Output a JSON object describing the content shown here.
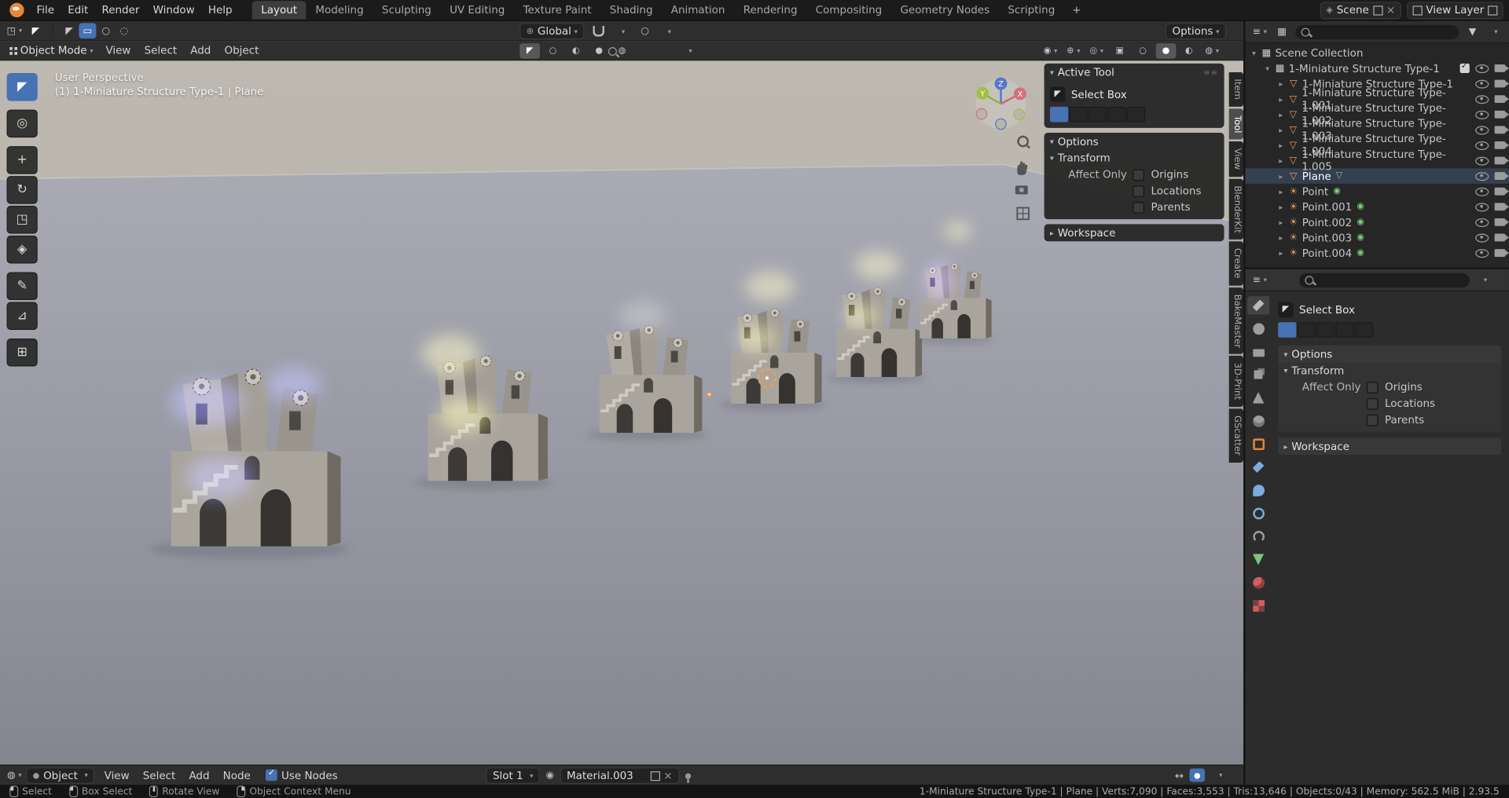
{
  "colors": {
    "accent_blue": "#4772b3",
    "accent_orange": "#e8883a",
    "header_bg": "#2e2e2e"
  },
  "topbar": {
    "menus": [
      {
        "label": "File"
      },
      {
        "label": "Edit"
      },
      {
        "label": "Render"
      },
      {
        "label": "Window"
      },
      {
        "label": "Help"
      }
    ],
    "workspaces": [
      {
        "label": "Layout",
        "cls": "active"
      },
      {
        "label": "Modeling"
      },
      {
        "label": "Sculpting"
      },
      {
        "label": "UV Editing"
      },
      {
        "label": "Texture Paint"
      },
      {
        "label": "Shading"
      },
      {
        "label": "Animation"
      },
      {
        "label": "Rendering"
      },
      {
        "label": "Compositing"
      },
      {
        "label": "Geometry Nodes"
      },
      {
        "label": "Scripting"
      }
    ],
    "add_workspace": "+",
    "scene_label": "Scene",
    "view_layer_label": "View Layer"
  },
  "tool_settings": {
    "select_modes": [
      {
        "name": "tweak-select-mode",
        "glyph": "◤"
      },
      {
        "name": "box-select-mode",
        "glyph": "▭",
        "cls": "active"
      },
      {
        "name": "circle-select-mode",
        "glyph": "○"
      },
      {
        "name": "lasso-select-mode",
        "glyph": "◌"
      }
    ],
    "orientation": "Global",
    "options_label": "Options"
  },
  "viewport_header": {
    "mode": "Object Mode",
    "menus": [
      {
        "label": "View"
      },
      {
        "label": "Select"
      },
      {
        "label": "Add"
      },
      {
        "label": "Object"
      }
    ],
    "center_icons": [
      {
        "name": "active-tool-icon",
        "glyph": "◤",
        "cls": "active"
      },
      {
        "name": "mode-wire-icon",
        "glyph": "○"
      },
      {
        "name": "mode-solid-icon",
        "glyph": "◐"
      },
      {
        "name": "mode-material-icon",
        "glyph": "●"
      },
      {
        "name": "mode-render-icon",
        "glyph": "◍"
      }
    ],
    "right_icons": [
      {
        "name": "visibility-toggle",
        "glyph": "◉",
        "dd": true
      },
      {
        "name": "gizmo-toggle",
        "glyph": "⊕",
        "dd": true
      },
      {
        "name": "overlays-toggle",
        "glyph": "◎",
        "dd": true
      },
      {
        "name": "xray-toggle",
        "glyph": "▣"
      },
      {
        "name": "shading-wireframe-toggle",
        "glyph": "○"
      },
      {
        "name": "shading-solid-toggle",
        "glyph": "●",
        "cls": "active"
      },
      {
        "name": "shading-material-toggle",
        "glyph": "◐"
      },
      {
        "name": "shading-rendered-toggle",
        "glyph": "◍",
        "dd": true
      }
    ]
  },
  "left_toolbar": [
    {
      "name": "select-box-tool",
      "glyph": "◤",
      "cls": "active"
    },
    {
      "name": "cursor-tool",
      "glyph": "◎"
    },
    {
      "name": "move-tool",
      "glyph": "+"
    },
    {
      "name": "rotate-tool",
      "glyph": "↻"
    },
    {
      "name": "scale-tool",
      "glyph": "◳"
    },
    {
      "name": "transform-tool",
      "glyph": "◈"
    },
    {
      "name": "annotate-tool",
      "glyph": "✎"
    },
    {
      "name": "measure-tool",
      "glyph": "⊿"
    },
    {
      "name": "add-cube-tool",
      "glyph": "⊞"
    }
  ],
  "viewport": {
    "perspective_label": "User Perspective",
    "context_label": "(1) 1-Miniature Structure Type-1 | Plane",
    "gizmo": {
      "x": "X",
      "y": "Y",
      "z": "Z"
    },
    "glow_colors": {
      "s1": "#5c5cf0",
      "s2": "#e3d84e",
      "s3": "#e0e0da",
      "s4": "#d9cf52",
      "s5": "#d9cf52",
      "s6": "#8a62f0"
    }
  },
  "sidebar": {
    "active_tool_header": "Active Tool",
    "tool_name": "Select Box",
    "mode_icons": [
      {
        "cls": "active"
      },
      {},
      {},
      {},
      {}
    ],
    "options_header": "Options",
    "transform_header": "Transform",
    "affect_items": [
      {
        "prefix": "Affect Only",
        "label": "Origins"
      },
      {
        "label": "Locations"
      },
      {
        "label": "Parents"
      }
    ],
    "workspace_header": "Workspace",
    "tabs": [
      {
        "label": "Item"
      },
      {
        "label": "Tool",
        "cls": "active"
      },
      {
        "label": "View"
      },
      {
        "label": "BlenderKit"
      },
      {
        "label": "Create"
      },
      {
        "label": "BakeMaster"
      },
      {
        "label": "3D-Print"
      },
      {
        "label": "GScatter"
      }
    ]
  },
  "outliner": {
    "rows": [
      {
        "label": "Scene Collection",
        "icon": "▦",
        "icon_style": "color:#cfcfcf",
        "indent": 0,
        "arrow": "▾"
      },
      {
        "label": "1-Miniature Structure Type-1",
        "icon": "▦",
        "icon_style": "color:#cfcfcf",
        "indent": 1,
        "arrow": "▾",
        "check": true,
        "eye": true,
        "cam": true
      },
      {
        "label": "1-Miniature Structure Type-1",
        "icon": "▽",
        "icon_style": "color:#ef9a54",
        "indent": 2,
        "arrow": "▸",
        "eye": true,
        "cam": true
      },
      {
        "label": "1-Miniature Structure Type-1.001",
        "icon": "▽",
        "icon_style": "color:#ef9a54",
        "indent": 2,
        "arrow": "▸",
        "eye": true,
        "cam": true
      },
      {
        "label": "1-Miniature Structure Type-1.002",
        "icon": "▽",
        "icon_style": "color:#ef9a54",
        "indent": 2,
        "arrow": "▸",
        "eye": true,
        "cam": true
      },
      {
        "label": "1-Miniature Structure Type-1.003",
        "icon": "▽",
        "icon_style": "color:#ef9a54",
        "indent": 2,
        "arrow": "▸",
        "eye": true,
        "cam": true
      },
      {
        "label": "1-Miniature Structure Type-1.004",
        "icon": "▽",
        "icon_style": "color:#ef9a54",
        "indent": 2,
        "arrow": "▸",
        "eye": true,
        "cam": true
      },
      {
        "label": "1-Miniature Structure Type-1.005",
        "icon": "▽",
        "icon_style": "color:#ef9a54",
        "indent": 2,
        "arrow": "▸",
        "eye": true,
        "cam": true
      },
      {
        "label": "Plane",
        "icon": "▽",
        "icon_style": "color:#ef9a54",
        "indent": 2,
        "arrow": "▸",
        "extra": "▽",
        "extra_style": "color:#7fca7f",
        "eye": true,
        "cam": true,
        "cls": "selected"
      },
      {
        "label": "Point",
        "icon": "☀",
        "icon_style": "color:#e09a5a",
        "indent": 2,
        "arrow": "▸",
        "extra": "◉",
        "extra_style": "color:#7fca7f",
        "eye": true,
        "cam": true
      },
      {
        "label": "Point.001",
        "icon": "☀",
        "icon_style": "color:#e09a5a",
        "indent": 2,
        "arrow": "▸",
        "extra": "◉",
        "extra_style": "color:#7fca7f",
        "eye": true,
        "cam": true
      },
      {
        "label": "Point.002",
        "icon": "☀",
        "icon_style": "color:#e09a5a",
        "indent": 2,
        "arrow": "▸",
        "extra": "◉",
        "extra_style": "color:#7fca7f",
        "eye": true,
        "cam": true
      },
      {
        "label": "Point.003",
        "icon": "☀",
        "icon_style": "color:#e09a5a",
        "indent": 2,
        "arrow": "▸",
        "extra": "◉",
        "extra_style": "color:#7fca7f",
        "eye": true,
        "cam": true
      },
      {
        "label": "Point.004",
        "icon": "☀",
        "icon_style": "color:#e09a5a",
        "indent": 2,
        "arrow": "▸",
        "extra": "◉",
        "extra_style": "color:#7fca7f",
        "eye": true,
        "cam": true
      }
    ]
  },
  "properties": {
    "tabs": [
      {
        "name": "tool-properties",
        "cls": "active",
        "style": "background:#b9b9b9;clip-path:polygon(0 65%,65% 0,100% 35%,35% 100%)"
      },
      {
        "name": "render-properties",
        "style": "background:#9d9d9d;border-radius:50%"
      },
      {
        "name": "output-properties",
        "style": "background:#9d9d9d;height:8px;margin-top:2px;border-radius:1px"
      },
      {
        "name": "view-layer-properties",
        "style": "background:#9d9d9d;width:9px;height:9px;border-radius:1px;box-shadow:3px -3px 0 -1px #777"
      },
      {
        "name": "scene-properties",
        "style": "background:#9d9d9d;clip-path:polygon(50% 0,100% 100%,0 100%)"
      },
      {
        "name": "world-properties",
        "style": "background:#9d9d9d;border-radius:50%;box-shadow:inset 0 -4px 0 #767676"
      },
      {
        "name": "object-properties",
        "style": "width:8px;height:8px;border:2px solid #e8883a;border-radius:2px"
      },
      {
        "name": "modifier-properties",
        "style": "background:#7cabdc;clip-path:polygon(0 60%,60% 0,100% 40%,40% 100%)"
      },
      {
        "name": "particle-properties",
        "style": "background:#7cabdc;border-radius:50% 50% 50% 0"
      },
      {
        "name": "physics-properties",
        "style": "width:8px;height:8px;border:2px solid #7cabdc;border-radius:50%"
      },
      {
        "name": "constraint-properties",
        "style": "width:8px;height:8px;border:2px solid #9d9d9d;border-radius:50%;border-bottom-color:transparent"
      },
      {
        "name": "object-data-properties",
        "style": "background:#7bc77b;clip-path:polygon(50% 100%,0 0,100% 0)"
      },
      {
        "name": "material-properties",
        "style": "background:#d05f5f;border-radius:50%;box-shadow:inset -3px -3px 0 #93403f"
      },
      {
        "name": "texture-properties",
        "style": "background:conic-gradient(#d05f5f 25%,#7a4141 0 50%,#d05f5f 0 75%,#7a4141 0)"
      }
    ],
    "tool_name": "Select Box",
    "mode_icons": [
      {
        "cls": "active"
      },
      {},
      {},
      {},
      {}
    ],
    "options_header": "Options",
    "transform_header": "Transform",
    "affect_items": [
      {
        "prefix": "Affect Only",
        "label": "Origins"
      },
      {
        "label": "Locations"
      },
      {
        "label": "Parents"
      }
    ],
    "workspace_header": "Workspace"
  },
  "shader_editor": {
    "object_mode": "Object",
    "menus": [
      {
        "label": "View"
      },
      {
        "label": "Select"
      },
      {
        "label": "Add"
      },
      {
        "label": "Node"
      }
    ],
    "use_nodes_label": "Use Nodes",
    "slot_label": "Slot 1",
    "material_name": "Material.003"
  },
  "statusbar": {
    "hints": [
      {
        "label": "Select",
        "btn": "left"
      },
      {
        "label": "Box Select",
        "btn": "drag"
      },
      {
        "label": "Rotate View",
        "btn": "middle"
      },
      {
        "label": "Object Context Menu",
        "btn": "right"
      }
    ],
    "stats": "1-Miniature Structure Type-1 | Plane | Verts:7,090 | Faces:3,553 | Tris:13,646 | Objects:0/43 | Memory: 562.5 MiB | 2.93.5"
  }
}
